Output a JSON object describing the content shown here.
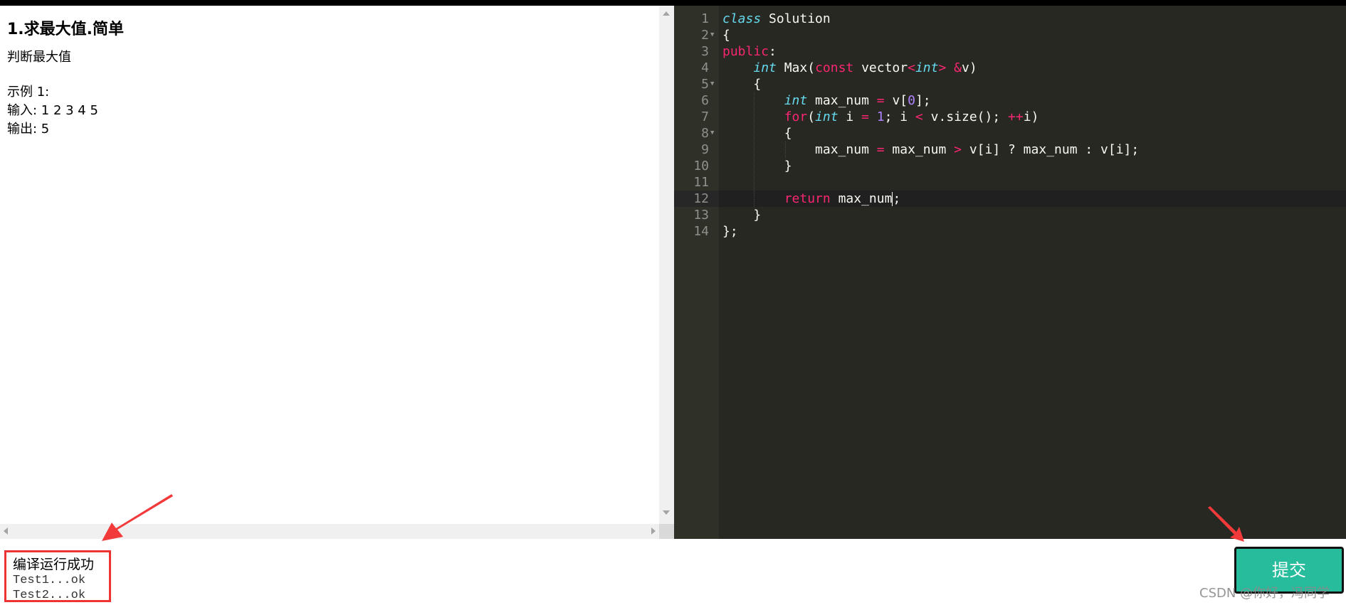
{
  "problem": {
    "title": "1.求最大值.简单",
    "description": "判断最大值",
    "example_label": "示例 1:",
    "input_line": "输入: 1 2 3 4 5",
    "output_line": "输出: 5"
  },
  "editor": {
    "line_numbers": [
      "1",
      "2",
      "3",
      "4",
      "5",
      "6",
      "7",
      "8",
      "9",
      "10",
      "11",
      "12",
      "13",
      "14"
    ],
    "active_line": 12,
    "fold_lines": [
      2,
      5,
      8
    ],
    "colors": {
      "background": "#272822",
      "gutter": "#2f3129",
      "keyword": "#f92672",
      "storage": "#66d9ef",
      "number": "#ae81ff",
      "text": "#f8f8f2"
    }
  },
  "result": {
    "status": "编译运行成功",
    "tests": [
      "Test1...ok",
      "Test2...ok"
    ]
  },
  "actions": {
    "submit_label": "提交",
    "submit_color": "#27bc9c"
  },
  "watermark": "CSDN @你好，冯同学",
  "annotation_color": "#e33"
}
